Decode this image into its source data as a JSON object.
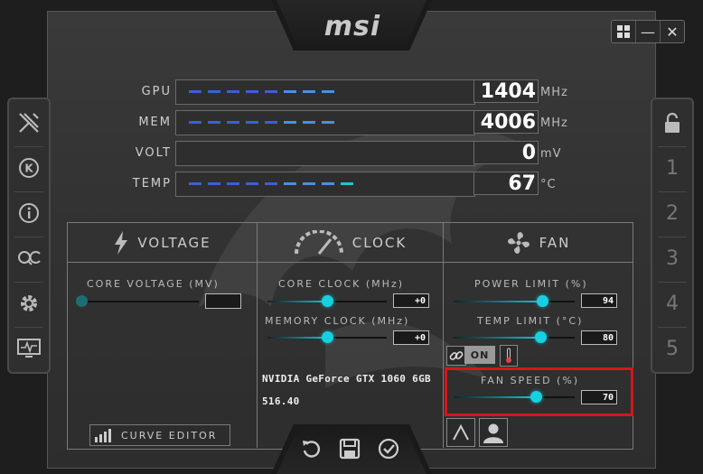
{
  "app": {
    "logo": "msi"
  },
  "window_controls": {
    "windows_icon": "windows-icon",
    "minimize": "—",
    "close": "✕"
  },
  "left_sidebar": {
    "items": [
      {
        "icon": "oc-scanner-icon"
      },
      {
        "icon": "kombustor-icon"
      },
      {
        "icon": "info-icon"
      },
      {
        "icon": "oc-icon"
      },
      {
        "icon": "settings-gear-icon"
      },
      {
        "icon": "monitoring-icon"
      }
    ]
  },
  "right_sidebar": {
    "lock_icon": "unlock-icon",
    "profiles": [
      "1",
      "2",
      "3",
      "4",
      "5"
    ]
  },
  "meters": [
    {
      "label": "GPU",
      "value": "1404",
      "unit": "MHz",
      "fill": 0.58
    },
    {
      "label": "MEM",
      "value": "4006",
      "unit": "MHz",
      "fill": 0.55
    },
    {
      "label": "VOLT",
      "value": "0",
      "unit": "mV",
      "fill": 0
    },
    {
      "label": "TEMP",
      "value": "67",
      "unit": "°C",
      "fill": 0.67
    }
  ],
  "sections": {
    "voltage": {
      "title": "VOLTAGE",
      "icon": "lightning-icon"
    },
    "clock": {
      "title": "CLOCK",
      "icon": "speedometer-icon"
    },
    "fan": {
      "title": "FAN",
      "icon": "fan-icon"
    }
  },
  "voltage": {
    "core_voltage_label": "CORE VOLTAGE  (MV)",
    "core_voltage_value": "",
    "core_voltage_level": 0.0
  },
  "clock": {
    "core_clock_label": "CORE CLOCK (MHz)",
    "core_clock_value": "+0",
    "core_clock_level": 0.5,
    "memory_clock_label": "MEMORY CLOCK (MHz)",
    "memory_clock_value": "+0",
    "memory_clock_level": 0.5
  },
  "gpu_info": {
    "name": "NVIDIA GeForce GTX 1060 6GB",
    "driver": "516.40"
  },
  "fan": {
    "power_limit_label": "POWER LIMIT (%)",
    "power_limit_value": "94",
    "power_limit_level": 0.73,
    "temp_limit_label": "TEMP LIMIT (°C)",
    "temp_limit_value": "80",
    "temp_limit_level": 0.72,
    "link_toggle_label": "ON",
    "fan_speed_label": "FAN SPEED (%)",
    "fan_speed_value": "70",
    "fan_speed_level": 0.68
  },
  "curve_editor_label": "CURVE EDITOR",
  "bottom_actions": [
    "reset-icon",
    "save-icon",
    "apply-check-icon"
  ],
  "fan_mode_buttons": [
    "auto-fan-icon",
    "user-profile-icon"
  ],
  "accent_color": "#16d0e0",
  "highlight_color": "#d4161c"
}
